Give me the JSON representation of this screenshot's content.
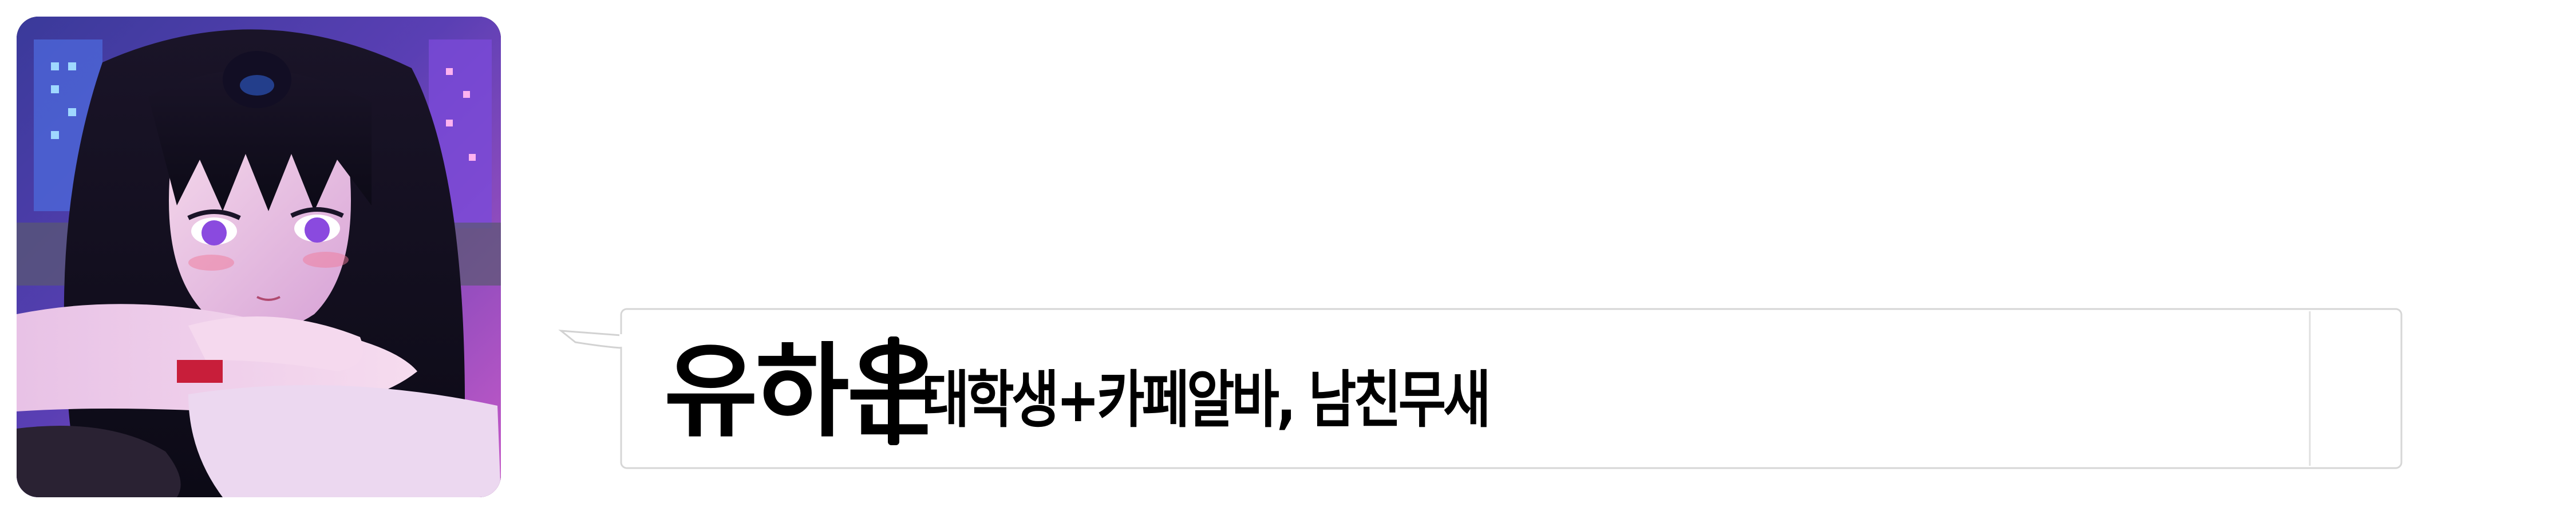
{
  "profile": {
    "name": "유하은",
    "description": "대학생+카페알바, 남친무새"
  },
  "colors": {
    "background": "#ffffff",
    "text": "#000000",
    "bubble_border": "#d6d6d6"
  }
}
